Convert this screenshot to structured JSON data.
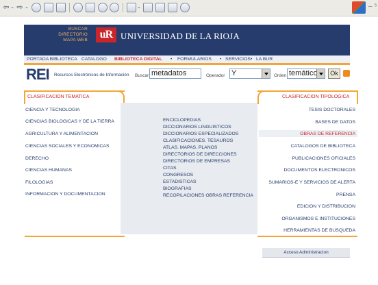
{
  "toolbar": {
    "back": "⇦",
    "forward": "⇨",
    "dash1": "-",
    "dash2": "-",
    "dash3": "-",
    "win_ctrl": "– ⁵"
  },
  "header": {
    "quick_links": [
      "BUSCAR",
      "DIRECTORIO",
      "MAPA WEB"
    ],
    "logo": "uR",
    "title": "UNIVERSIDAD DE LA RIOJA",
    "nav": [
      "PORTADA BIBLIOTECA",
      "CATALOGO",
      "BIBLIOTECA DIGITAL",
      "FORMULARIOS",
      "SERVICIOS",
      "LA BUR"
    ],
    "nav_sep": "•",
    "brand_colors": {
      "navy": "#263c6c",
      "orange": "#f3a638",
      "red": "#c8262c"
    }
  },
  "search": {
    "rei": "REI",
    "rei_sub": "Recursos Electrónicos de Información",
    "buscar_label": "Buscar",
    "buscar_value": "metadatos",
    "operador_label": "Operador",
    "operador_value": "Y",
    "orden_label": "Orden",
    "orden_value": "temático",
    "ok_label": "Ok"
  },
  "clasificacion_tematica": {
    "title": "CLASIFICACION TEMATICA",
    "items": [
      "CIENCIA Y TECNOLOGIA",
      "CIENCIAS BIOLOGICAS Y DE LA TIERRA",
      "AGRICULTURA Y ALIMENTACION",
      "CIENCIAS SOCIALES Y ECONOMICAS",
      "DERECHO",
      "CIENCIAS HUMANAS",
      "FILOLOGIAS",
      "INFORMACION Y DOCUMENTACION"
    ]
  },
  "tipos_centro": {
    "items": [
      "ENCICLOPEDIAS",
      "DICCIONARIOS LINGUISTICOS",
      "DICCIONARIOS ESPECIALIZADOS",
      "CLASIFICACIONES. TESAUROS",
      "ATLAS. MAPAS. PLANOS",
      "DIRECTORIOS DE DIRECCIONES",
      "DIRECTORIOS DE EMPRESAS",
      "CITAS",
      "CONGRESOS",
      "ESTADISTICAS",
      "BIOGRAFIAS",
      "RECOPILACIONES OBRAS REFERENCIA"
    ]
  },
  "clasificacion_tipologica": {
    "title": "CLASIFICACION TIPOLOGICA",
    "items": [
      "TESIS DOCTORALES",
      "BASES DE DATOS",
      "OBRAS DE REFERENCIA",
      "CATALOGOS DE BIBLIOTECA",
      "PUBLICACIONES OFICIALES",
      "DOCUMENTOS ELECTRONICOS",
      "SUMARIOS-E Y SERVICIOS DE ALERTA",
      "PRENSA",
      "EDICION Y DISTRIBUCION",
      "ORGANISMOS E INSTITUCIONES",
      "HERRAMIENTAS DE BUSQUEDA"
    ],
    "selected": "OBRAS DE REFERENCIA"
  },
  "admin": {
    "label": "Acceso Administracion"
  }
}
